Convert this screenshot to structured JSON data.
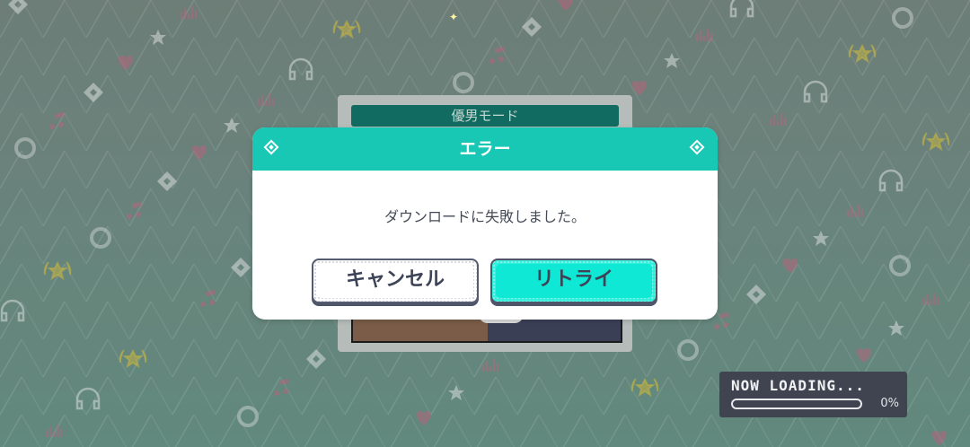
{
  "behind_card": {
    "title": "優男モード"
  },
  "dialog": {
    "title": "エラー",
    "message": "ダウンロードに失敗しました。",
    "cancel_label": "キャンセル",
    "retry_label": "リトライ"
  },
  "loading": {
    "label": "NOW LOADING...",
    "percent_text": "0%",
    "progress": 0
  },
  "colors": {
    "accent": "#19c8b4",
    "retry_button": "#10e8d6",
    "button_border": "#4e5568",
    "behind_title_bg": "#116b60"
  },
  "background": {
    "icon_types": [
      "heart-icon",
      "star-icon",
      "diamond-icon",
      "music-note-icon",
      "disc-icon",
      "headphones-icon",
      "trophy-icon",
      "equalizer-icon"
    ]
  }
}
